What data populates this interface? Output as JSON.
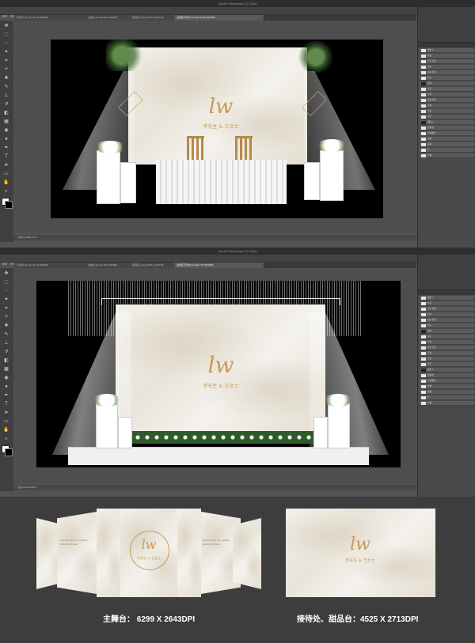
{
  "screens": [
    {
      "window_title": "Adobe Photoshop CC 2018",
      "status_text": "文档:18.4M/1.13G",
      "tabs": [
        "背景01.psd @ 33.3% (RGB/8)",
        "主舞台.psd @ 25% (RGB/8)",
        "签到区.psd @ 50% (CMYK/8)",
        "迎宾区背景00.psd @ 33.3% (RGB/8)"
      ]
    },
    {
      "window_title": "Adobe Photoshop CC 2018",
      "status_text": "文档:26.1M/2.66G",
      "tabs": [
        "背景01.psd @ 33.3% (RGB/8)",
        "主舞台.psd @ 25% (RGB/8)",
        "签到区.psd @ 50% (CMYK/8)",
        "迎宾区背景00.psd @ 17% (RGB/8)"
      ]
    }
  ],
  "panel": {
    "layers": [
      "图层 1",
      "拷贝",
      "花艺 拷贝",
      "白纱",
      "白纱 拷贝",
      "椅子",
      "桌布",
      "桌子",
      "背景",
      "装饰 拷贝",
      "花盒",
      "灯架",
      "花艺",
      "图层 2",
      "装饰线",
      "背景图层",
      "效果",
      "蒙版",
      "灯",
      "纱幔"
    ]
  },
  "design": {
    "logo": "lw",
    "names": "李先生 & 王女士",
    "invitation_text": "Just you and me, together forever with love"
  },
  "captions": {
    "main_stage": "主舞台： 6299 X 2643DPI",
    "reception": "接待处、甜品台：4525 X 2713DPI"
  },
  "colors": {
    "gold": "#c99a52",
    "ps_dark": "#2e2e2e",
    "canvas_bg": "#000000"
  }
}
